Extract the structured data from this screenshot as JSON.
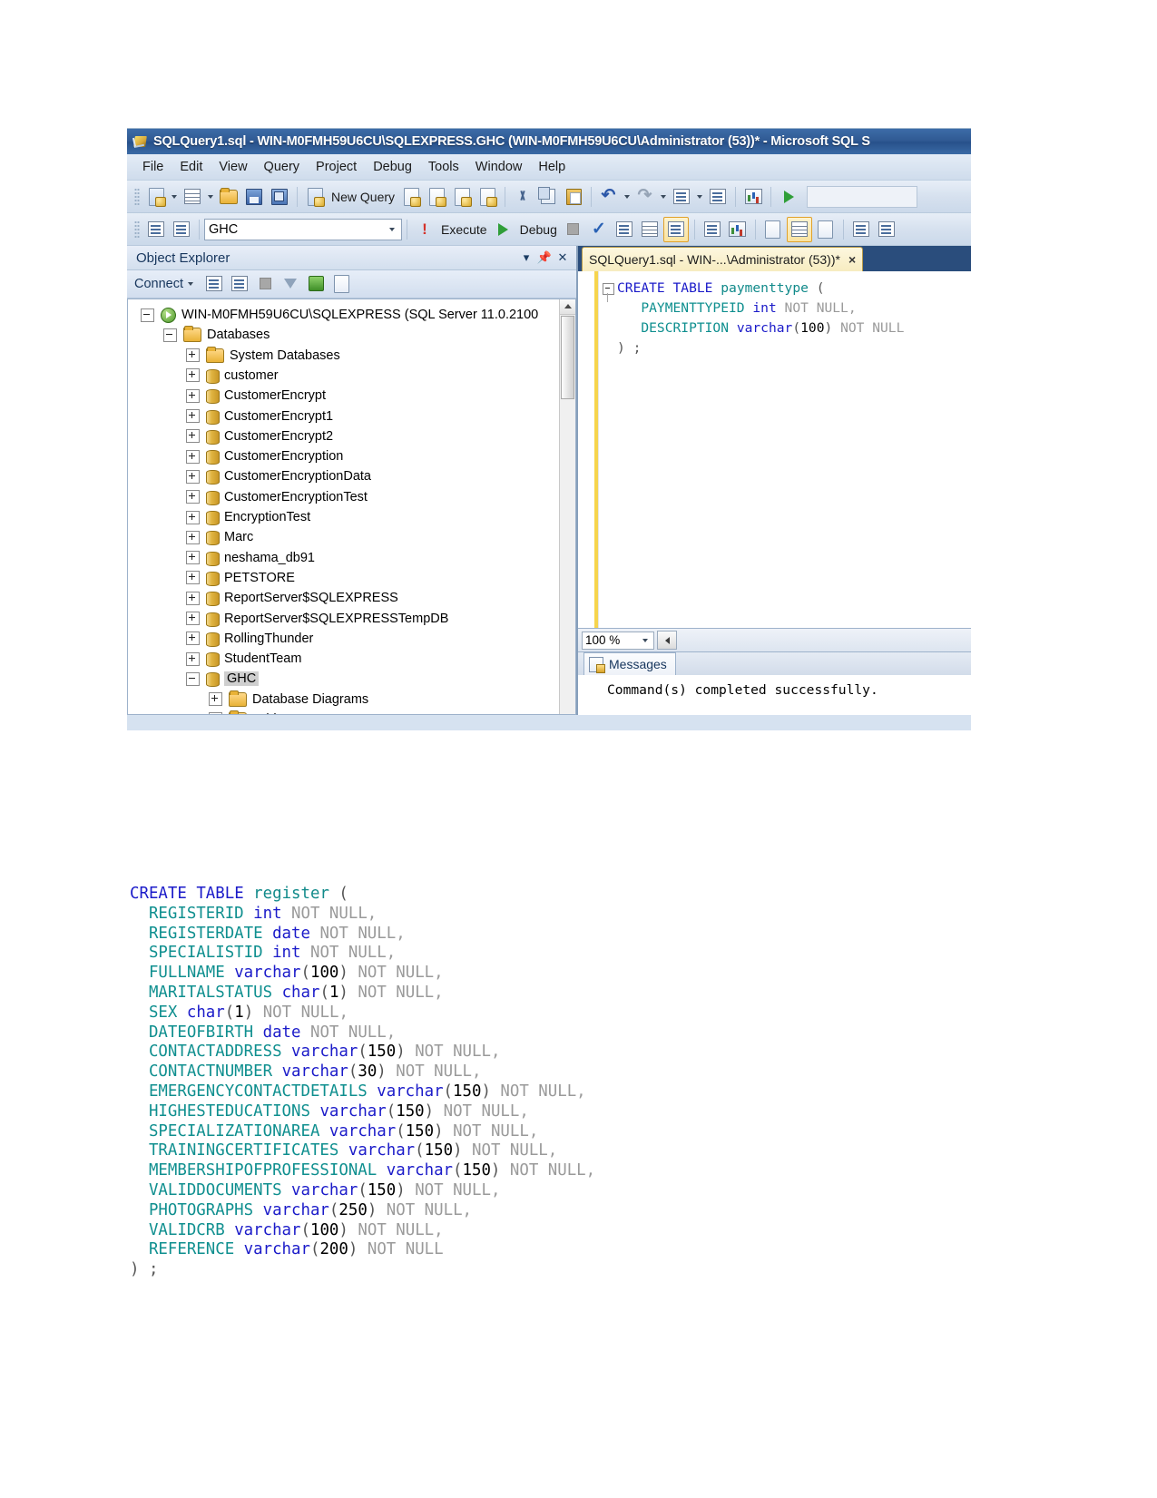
{
  "window": {
    "title": "SQLQuery1.sql - WIN-M0FMH59U6CU\\SQLEXPRESS.GHC (WIN-M0FMH59U6CU\\Administrator (53))* - Microsoft SQL S",
    "app_icon": "sql-query-file-icon"
  },
  "menubar": {
    "items": [
      "File",
      "Edit",
      "View",
      "Query",
      "Project",
      "Debug",
      "Tools",
      "Window",
      "Help"
    ]
  },
  "toolbar_main": {
    "new_query_label": "New Query",
    "icons": [
      "new-item-icon",
      "new-project-icon",
      "open-folder-icon",
      "save-icon",
      "save-all-icon",
      "new-query-icon",
      "new-db-engine-query-icon",
      "new-analysis-mdx-query-icon",
      "new-analysis-dmx-query-icon",
      "new-analysis-xmla-query-icon",
      "cut-icon",
      "copy-icon",
      "paste-icon",
      "undo-icon",
      "redo-icon",
      "navigate-backward-icon",
      "navigate-forward-icon",
      "chart-icon",
      "run-icon"
    ]
  },
  "toolbar_query": {
    "database_selector_value": "GHC",
    "execute_label": "Execute",
    "debug_label": "Debug",
    "icons": [
      "connect-icon",
      "disconnect-icon",
      "execute-bang-icon",
      "run-arrow-icon",
      "stop-icon",
      "parse-check-icon",
      "display-estimated-plan-icon",
      "query-options-icon",
      "results-to-text-icon",
      "include-actual-plan-icon",
      "include-client-statistics-icon",
      "results-to-grid-icon",
      "results-to-file-icon",
      "comment-icon",
      "uncomment-icon"
    ]
  },
  "object_explorer": {
    "title": "Object Explorer",
    "header_buttons": [
      "chevron-down-icon",
      "pin-icon",
      "close-icon"
    ],
    "connect_label": "Connect",
    "toolbar_icons": [
      "connect-object-explorer-icon",
      "disconnect-object-explorer-icon",
      "stop-icon",
      "filter-icon",
      "refresh-icon",
      "script-error-icon"
    ],
    "tree": [
      {
        "label": "WIN-M0FMH59U6CU\\SQLEXPRESS (SQL Server 11.0.2100",
        "indent": 0,
        "state": "minus",
        "icon": "server-icon",
        "selected": false
      },
      {
        "label": "Databases",
        "indent": 1,
        "state": "minus",
        "icon": "folder-icon",
        "selected": false
      },
      {
        "label": "System Databases",
        "indent": 2,
        "state": "plus",
        "icon": "folder-icon",
        "selected": false
      },
      {
        "label": "customer",
        "indent": 2,
        "state": "plus",
        "icon": "database-icon",
        "selected": false
      },
      {
        "label": "CustomerEncrypt",
        "indent": 2,
        "state": "plus",
        "icon": "database-icon",
        "selected": false
      },
      {
        "label": "CustomerEncrypt1",
        "indent": 2,
        "state": "plus",
        "icon": "database-icon",
        "selected": false
      },
      {
        "label": "CustomerEncrypt2",
        "indent": 2,
        "state": "plus",
        "icon": "database-icon",
        "selected": false
      },
      {
        "label": "CustomerEncryption",
        "indent": 2,
        "state": "plus",
        "icon": "database-icon",
        "selected": false
      },
      {
        "label": "CustomerEncryptionData",
        "indent": 2,
        "state": "plus",
        "icon": "database-icon",
        "selected": false
      },
      {
        "label": "CustomerEncryptionTest",
        "indent": 2,
        "state": "plus",
        "icon": "database-icon",
        "selected": false
      },
      {
        "label": "EncryptionTest",
        "indent": 2,
        "state": "plus",
        "icon": "database-icon",
        "selected": false
      },
      {
        "label": "Marc",
        "indent": 2,
        "state": "plus",
        "icon": "database-icon",
        "selected": false
      },
      {
        "label": "neshama_db91",
        "indent": 2,
        "state": "plus",
        "icon": "database-icon",
        "selected": false
      },
      {
        "label": "PETSTORE",
        "indent": 2,
        "state": "plus",
        "icon": "database-icon",
        "selected": false
      },
      {
        "label": "ReportServer$SQLEXPRESS",
        "indent": 2,
        "state": "plus",
        "icon": "database-icon",
        "selected": false
      },
      {
        "label": "ReportServer$SQLEXPRESSTempDB",
        "indent": 2,
        "state": "plus",
        "icon": "database-icon",
        "selected": false
      },
      {
        "label": "RollingThunder",
        "indent": 2,
        "state": "plus",
        "icon": "database-icon",
        "selected": false
      },
      {
        "label": "StudentTeam",
        "indent": 2,
        "state": "plus",
        "icon": "database-icon",
        "selected": false
      },
      {
        "label": "GHC",
        "indent": 2,
        "state": "minus",
        "icon": "database-icon",
        "selected": true
      },
      {
        "label": "Database Diagrams",
        "indent": 3,
        "state": "plus",
        "icon": "folder-icon",
        "selected": false
      },
      {
        "label": "Tables",
        "indent": 3,
        "state": "minus",
        "icon": "folder-icon",
        "selected": false
      }
    ]
  },
  "editor": {
    "tab_label": "SQLQuery1.sql - WIN-...\\Administrator (53))*",
    "tab_close": "×",
    "code_lines": [
      [
        {
          "t": "CREATE",
          "c": "kw"
        },
        {
          "t": " ",
          "c": "punc"
        },
        {
          "t": "TABLE",
          "c": "kw"
        },
        {
          "t": " ",
          "c": "punc"
        },
        {
          "t": "paymenttype",
          "c": "tbl"
        },
        {
          "t": " (",
          "c": "punc"
        }
      ],
      [
        {
          "t": "   ",
          "c": "punc"
        },
        {
          "t": "PAYMENTTYPEID",
          "c": "col"
        },
        {
          "t": " ",
          "c": "punc"
        },
        {
          "t": "int",
          "c": "typ"
        },
        {
          "t": " ",
          "c": "punc"
        },
        {
          "t": "NOT NULL,",
          "c": "nul"
        }
      ],
      [
        {
          "t": "   ",
          "c": "punc"
        },
        {
          "t": "DESCRIPTION",
          "c": "col"
        },
        {
          "t": " ",
          "c": "punc"
        },
        {
          "t": "varchar",
          "c": "typ"
        },
        {
          "t": "(",
          "c": "punc"
        },
        {
          "t": "100",
          "c": "num"
        },
        {
          "t": ")",
          "c": "punc"
        },
        {
          "t": " ",
          "c": "punc"
        },
        {
          "t": "NOT NULL",
          "c": "nul"
        }
      ],
      [
        {
          "t": ") ;",
          "c": "punc"
        }
      ]
    ]
  },
  "zoombar": {
    "zoom_value": "100 %"
  },
  "messages": {
    "tab_label": "Messages",
    "tab_icon": "messages-icon",
    "text": "Command(s) completed successfully."
  },
  "sql_document": {
    "lines": [
      [
        {
          "t": "CREATE",
          "c": "kw"
        },
        {
          "t": " ",
          "c": "punc"
        },
        {
          "t": "TABLE",
          "c": "kw"
        },
        {
          "t": " ",
          "c": "punc"
        },
        {
          "t": "register",
          "c": "tbl"
        },
        {
          "t": " (",
          "c": "punc"
        }
      ],
      [
        {
          "t": "  ",
          "c": "punc"
        },
        {
          "t": "REGISTERID",
          "c": "col"
        },
        {
          "t": " ",
          "c": "punc"
        },
        {
          "t": "int",
          "c": "typ"
        },
        {
          "t": " ",
          "c": "punc"
        },
        {
          "t": "NOT NULL,",
          "c": "nul"
        }
      ],
      [
        {
          "t": "  ",
          "c": "punc"
        },
        {
          "t": "REGISTERDATE",
          "c": "col"
        },
        {
          "t": " ",
          "c": "punc"
        },
        {
          "t": "date",
          "c": "typ"
        },
        {
          "t": " ",
          "c": "punc"
        },
        {
          "t": "NOT NULL,",
          "c": "nul"
        }
      ],
      [
        {
          "t": "  ",
          "c": "punc"
        },
        {
          "t": "SPECIALISTID",
          "c": "col"
        },
        {
          "t": " ",
          "c": "punc"
        },
        {
          "t": "int",
          "c": "typ"
        },
        {
          "t": " ",
          "c": "punc"
        },
        {
          "t": "NOT NULL,",
          "c": "nul"
        }
      ],
      [
        {
          "t": "  ",
          "c": "punc"
        },
        {
          "t": "FULLNAME",
          "c": "col"
        },
        {
          "t": " ",
          "c": "punc"
        },
        {
          "t": "varchar",
          "c": "typ"
        },
        {
          "t": "(",
          "c": "punc"
        },
        {
          "t": "100",
          "c": "num"
        },
        {
          "t": ")",
          "c": "punc"
        },
        {
          "t": " ",
          "c": "punc"
        },
        {
          "t": "NOT NULL,",
          "c": "nul"
        }
      ],
      [
        {
          "t": "  ",
          "c": "punc"
        },
        {
          "t": "MARITALSTATUS",
          "c": "col"
        },
        {
          "t": " ",
          "c": "punc"
        },
        {
          "t": "char",
          "c": "typ"
        },
        {
          "t": "(",
          "c": "punc"
        },
        {
          "t": "1",
          "c": "num"
        },
        {
          "t": ")",
          "c": "punc"
        },
        {
          "t": " ",
          "c": "punc"
        },
        {
          "t": "NOT NULL,",
          "c": "nul"
        }
      ],
      [
        {
          "t": "  ",
          "c": "punc"
        },
        {
          "t": "SEX",
          "c": "col"
        },
        {
          "t": " ",
          "c": "punc"
        },
        {
          "t": "char",
          "c": "typ"
        },
        {
          "t": "(",
          "c": "punc"
        },
        {
          "t": "1",
          "c": "num"
        },
        {
          "t": ")",
          "c": "punc"
        },
        {
          "t": " ",
          "c": "punc"
        },
        {
          "t": "NOT NULL,",
          "c": "nul"
        }
      ],
      [
        {
          "t": "  ",
          "c": "punc"
        },
        {
          "t": "DATEOFBIRTH",
          "c": "col"
        },
        {
          "t": " ",
          "c": "punc"
        },
        {
          "t": "date",
          "c": "typ"
        },
        {
          "t": " ",
          "c": "punc"
        },
        {
          "t": "NOT NULL,",
          "c": "nul"
        }
      ],
      [
        {
          "t": "  ",
          "c": "punc"
        },
        {
          "t": "CONTACTADDRESS",
          "c": "col"
        },
        {
          "t": " ",
          "c": "punc"
        },
        {
          "t": "varchar",
          "c": "typ"
        },
        {
          "t": "(",
          "c": "punc"
        },
        {
          "t": "150",
          "c": "num"
        },
        {
          "t": ")",
          "c": "punc"
        },
        {
          "t": " ",
          "c": "punc"
        },
        {
          "t": "NOT NULL,",
          "c": "nul"
        }
      ],
      [
        {
          "t": "  ",
          "c": "punc"
        },
        {
          "t": "CONTACTNUMBER",
          "c": "col"
        },
        {
          "t": " ",
          "c": "punc"
        },
        {
          "t": "varchar",
          "c": "typ"
        },
        {
          "t": "(",
          "c": "punc"
        },
        {
          "t": "30",
          "c": "num"
        },
        {
          "t": ")",
          "c": "punc"
        },
        {
          "t": " ",
          "c": "punc"
        },
        {
          "t": "NOT NULL,",
          "c": "nul"
        }
      ],
      [
        {
          "t": "  ",
          "c": "punc"
        },
        {
          "t": "EMERGENCYCONTACTDETAILS",
          "c": "col"
        },
        {
          "t": " ",
          "c": "punc"
        },
        {
          "t": "varchar",
          "c": "typ"
        },
        {
          "t": "(",
          "c": "punc"
        },
        {
          "t": "150",
          "c": "num"
        },
        {
          "t": ")",
          "c": "punc"
        },
        {
          "t": " ",
          "c": "punc"
        },
        {
          "t": "NOT NULL,",
          "c": "nul"
        }
      ],
      [
        {
          "t": "  ",
          "c": "punc"
        },
        {
          "t": "HIGHESTEDUCATIONS",
          "c": "col"
        },
        {
          "t": " ",
          "c": "punc"
        },
        {
          "t": "varchar",
          "c": "typ"
        },
        {
          "t": "(",
          "c": "punc"
        },
        {
          "t": "150",
          "c": "num"
        },
        {
          "t": ")",
          "c": "punc"
        },
        {
          "t": " ",
          "c": "punc"
        },
        {
          "t": "NOT NULL,",
          "c": "nul"
        }
      ],
      [
        {
          "t": "  ",
          "c": "punc"
        },
        {
          "t": "SPECIALIZATIONAREA",
          "c": "col"
        },
        {
          "t": " ",
          "c": "punc"
        },
        {
          "t": "varchar",
          "c": "typ"
        },
        {
          "t": "(",
          "c": "punc"
        },
        {
          "t": "150",
          "c": "num"
        },
        {
          "t": ")",
          "c": "punc"
        },
        {
          "t": " ",
          "c": "punc"
        },
        {
          "t": "NOT NULL,",
          "c": "nul"
        }
      ],
      [
        {
          "t": "  ",
          "c": "punc"
        },
        {
          "t": "TRAININGCERTIFICATES",
          "c": "col"
        },
        {
          "t": " ",
          "c": "punc"
        },
        {
          "t": "varchar",
          "c": "typ"
        },
        {
          "t": "(",
          "c": "punc"
        },
        {
          "t": "150",
          "c": "num"
        },
        {
          "t": ")",
          "c": "punc"
        },
        {
          "t": " ",
          "c": "punc"
        },
        {
          "t": "NOT NULL,",
          "c": "nul"
        }
      ],
      [
        {
          "t": "  ",
          "c": "punc"
        },
        {
          "t": "MEMBERSHIPOFPROFESSIONAL",
          "c": "col"
        },
        {
          "t": " ",
          "c": "punc"
        },
        {
          "t": "varchar",
          "c": "typ"
        },
        {
          "t": "(",
          "c": "punc"
        },
        {
          "t": "150",
          "c": "num"
        },
        {
          "t": ")",
          "c": "punc"
        },
        {
          "t": " ",
          "c": "punc"
        },
        {
          "t": "NOT NULL,",
          "c": "nul"
        }
      ],
      [
        {
          "t": "  ",
          "c": "punc"
        },
        {
          "t": "VALIDDOCUMENTS",
          "c": "col"
        },
        {
          "t": " ",
          "c": "punc"
        },
        {
          "t": "varchar",
          "c": "typ"
        },
        {
          "t": "(",
          "c": "punc"
        },
        {
          "t": "150",
          "c": "num"
        },
        {
          "t": ")",
          "c": "punc"
        },
        {
          "t": " ",
          "c": "punc"
        },
        {
          "t": "NOT NULL,",
          "c": "nul"
        }
      ],
      [
        {
          "t": "  ",
          "c": "punc"
        },
        {
          "t": "PHOTOGRAPHS",
          "c": "col"
        },
        {
          "t": " ",
          "c": "punc"
        },
        {
          "t": "varchar",
          "c": "typ"
        },
        {
          "t": "(",
          "c": "punc"
        },
        {
          "t": "250",
          "c": "num"
        },
        {
          "t": ")",
          "c": "punc"
        },
        {
          "t": " ",
          "c": "punc"
        },
        {
          "t": "NOT NULL,",
          "c": "nul"
        }
      ],
      [
        {
          "t": "  ",
          "c": "punc"
        },
        {
          "t": "VALIDCRB",
          "c": "col"
        },
        {
          "t": " ",
          "c": "punc"
        },
        {
          "t": "varchar",
          "c": "typ"
        },
        {
          "t": "(",
          "c": "punc"
        },
        {
          "t": "100",
          "c": "num"
        },
        {
          "t": ")",
          "c": "punc"
        },
        {
          "t": " ",
          "c": "punc"
        },
        {
          "t": "NOT NULL,",
          "c": "nul"
        }
      ],
      [
        {
          "t": "  ",
          "c": "punc"
        },
        {
          "t": "REFERENCE",
          "c": "col"
        },
        {
          "t": " ",
          "c": "punc"
        },
        {
          "t": "varchar",
          "c": "typ"
        },
        {
          "t": "(",
          "c": "punc"
        },
        {
          "t": "200",
          "c": "num"
        },
        {
          "t": ")",
          "c": "punc"
        },
        {
          "t": " ",
          "c": "punc"
        },
        {
          "t": "NOT NULL",
          "c": "nul"
        }
      ],
      [
        {
          "t": ") ;",
          "c": "punc"
        }
      ]
    ]
  },
  "colors": {
    "titlebar": "#2f5992",
    "keyword": "#1b1bc9",
    "identifier": "#0f8f8f",
    "nullable": "#9a9a9a",
    "tab_active": "#f7ecc0"
  }
}
